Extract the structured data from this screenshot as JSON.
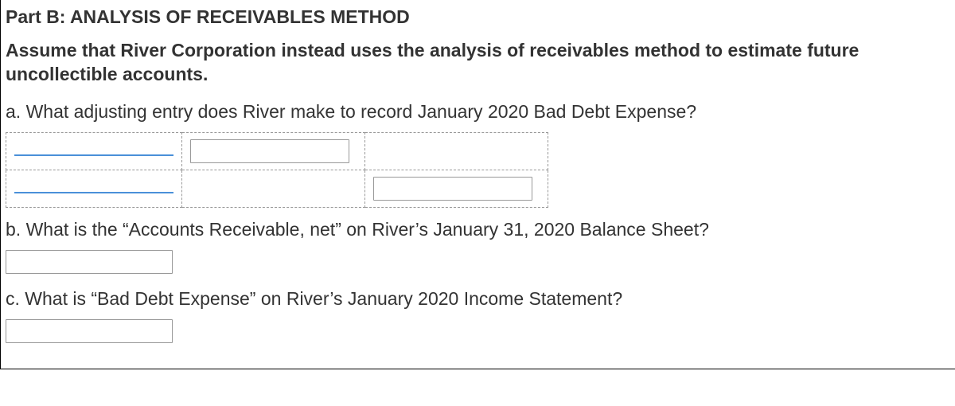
{
  "heading": "Part B: ANALYSIS OF RECEIVABLES METHOD",
  "instruction": "Assume that River Corporation instead uses the analysis of receivables method to estimate future uncollectible accounts.",
  "question_a": "a. What adjusting entry does River make to record January 2020 Bad Debt Expense?",
  "question_b": "b. What is the “Accounts Receivable, net” on River’s January 31, 2020 Balance Sheet?",
  "question_c": "c. What is “Bad Debt Expense” on River’s January 2020 Income Statement?",
  "inputs": {
    "debit_amount": "",
    "credit_amount": "",
    "ar_net": "",
    "bad_debt_expense": ""
  }
}
